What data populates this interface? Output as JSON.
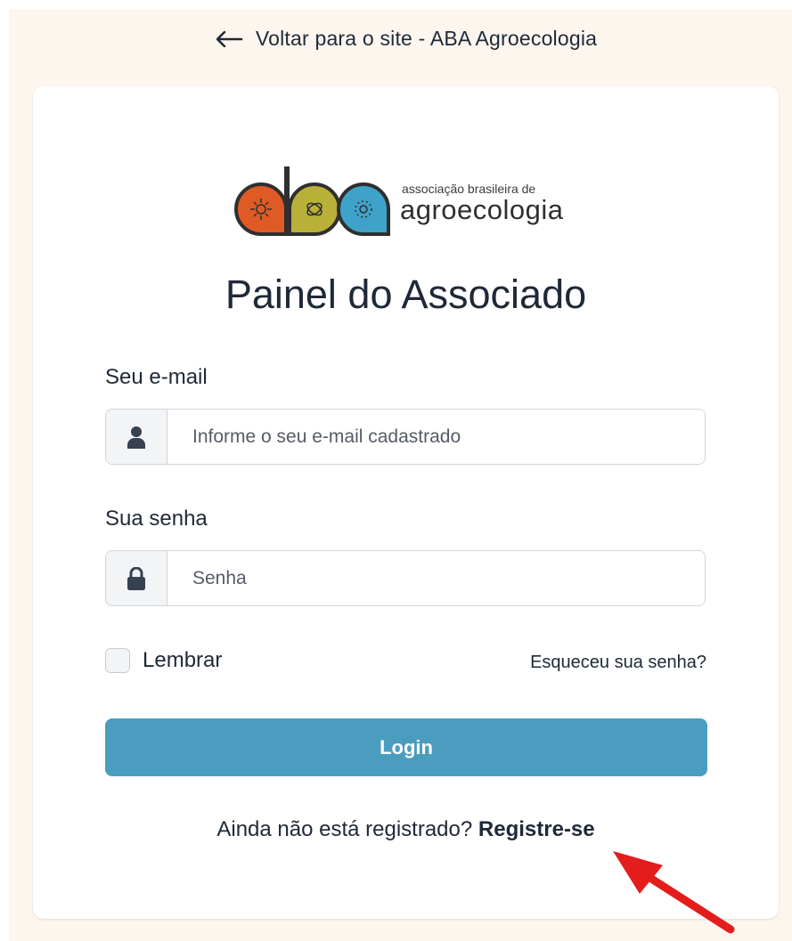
{
  "back_link": {
    "label": "Voltar para o site - ABA Agroecologia"
  },
  "logo": {
    "wordmark_line1": "associação brasileira de",
    "wordmark_line2": "agroecologia",
    "colors": {
      "orange": "#e05a25",
      "olive": "#b9b03a",
      "blue": "#3fa3c9",
      "dark": "#2f2f2f"
    }
  },
  "title": "Painel do Associado",
  "email": {
    "label": "Seu e-mail",
    "placeholder": "Informe o seu e-mail cadastrado",
    "icon": "user-icon"
  },
  "password": {
    "label": "Sua senha",
    "placeholder": "Senha",
    "icon": "lock-icon"
  },
  "remember": {
    "label": "Lembrar",
    "checked": false
  },
  "forgot_link": "Esqueceu sua senha?",
  "login_button": "Login",
  "register": {
    "prompt": "Ainda não está registrado?",
    "link": "Registre-se"
  },
  "colors": {
    "page_bg": "#fdf6ef",
    "primary": "#4a9dbf",
    "annotation_arrow": "#e51c1c"
  }
}
